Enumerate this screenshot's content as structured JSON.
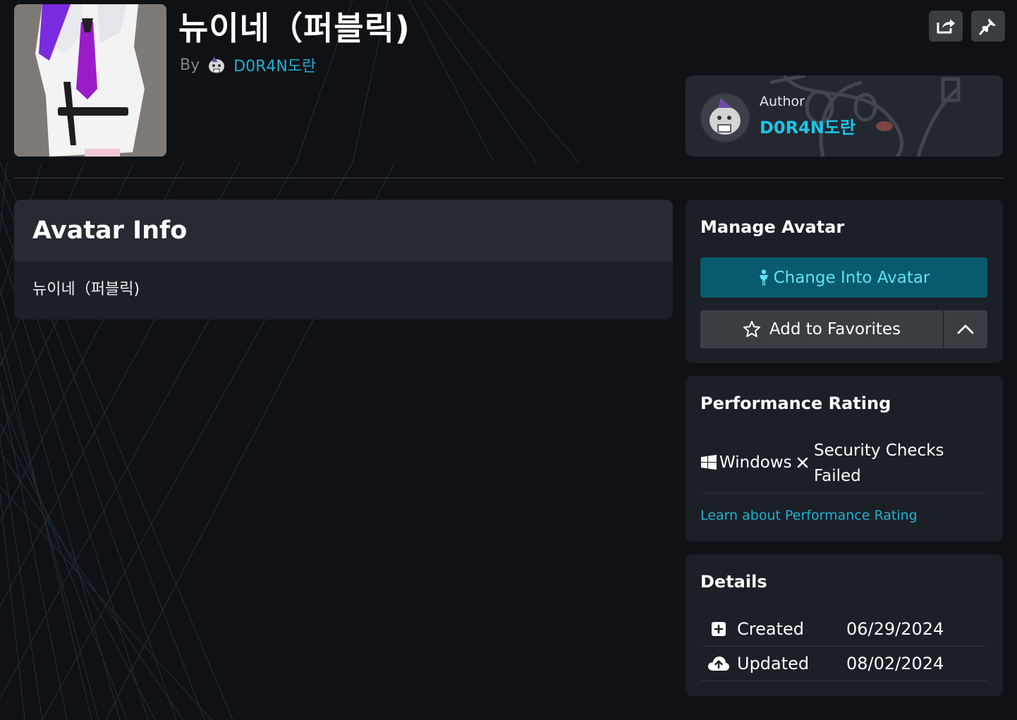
{
  "header": {
    "title": "뉴이네（퍼블릭)",
    "by_label": "By",
    "author_name": "D0R4N도란"
  },
  "author_card": {
    "label": "Author",
    "name": "D0R4N도란"
  },
  "avatar_info": {
    "heading": "Avatar Info",
    "description": "뉴이네（퍼블릭)"
  },
  "manage": {
    "heading": "Manage Avatar",
    "change_label": "Change Into Avatar",
    "favorite_label": "Add to Favorites"
  },
  "performance": {
    "heading": "Performance Rating",
    "platform": "Windows",
    "status": "Security Checks Failed",
    "learn_link": "Learn about Performance Rating"
  },
  "details": {
    "heading": "Details",
    "rows": [
      {
        "label": "Created",
        "value": "06/29/2024",
        "icon": "plus-square-icon"
      },
      {
        "label": "Updated",
        "value": "08/02/2024",
        "icon": "cloud-upload-icon"
      }
    ]
  },
  "colors": {
    "background": "#0f1115",
    "card": "#1b1f26",
    "accent": "#1fb1d1",
    "primary_button": "#085a6c",
    "primary_button_text": "#5fe2f7"
  }
}
